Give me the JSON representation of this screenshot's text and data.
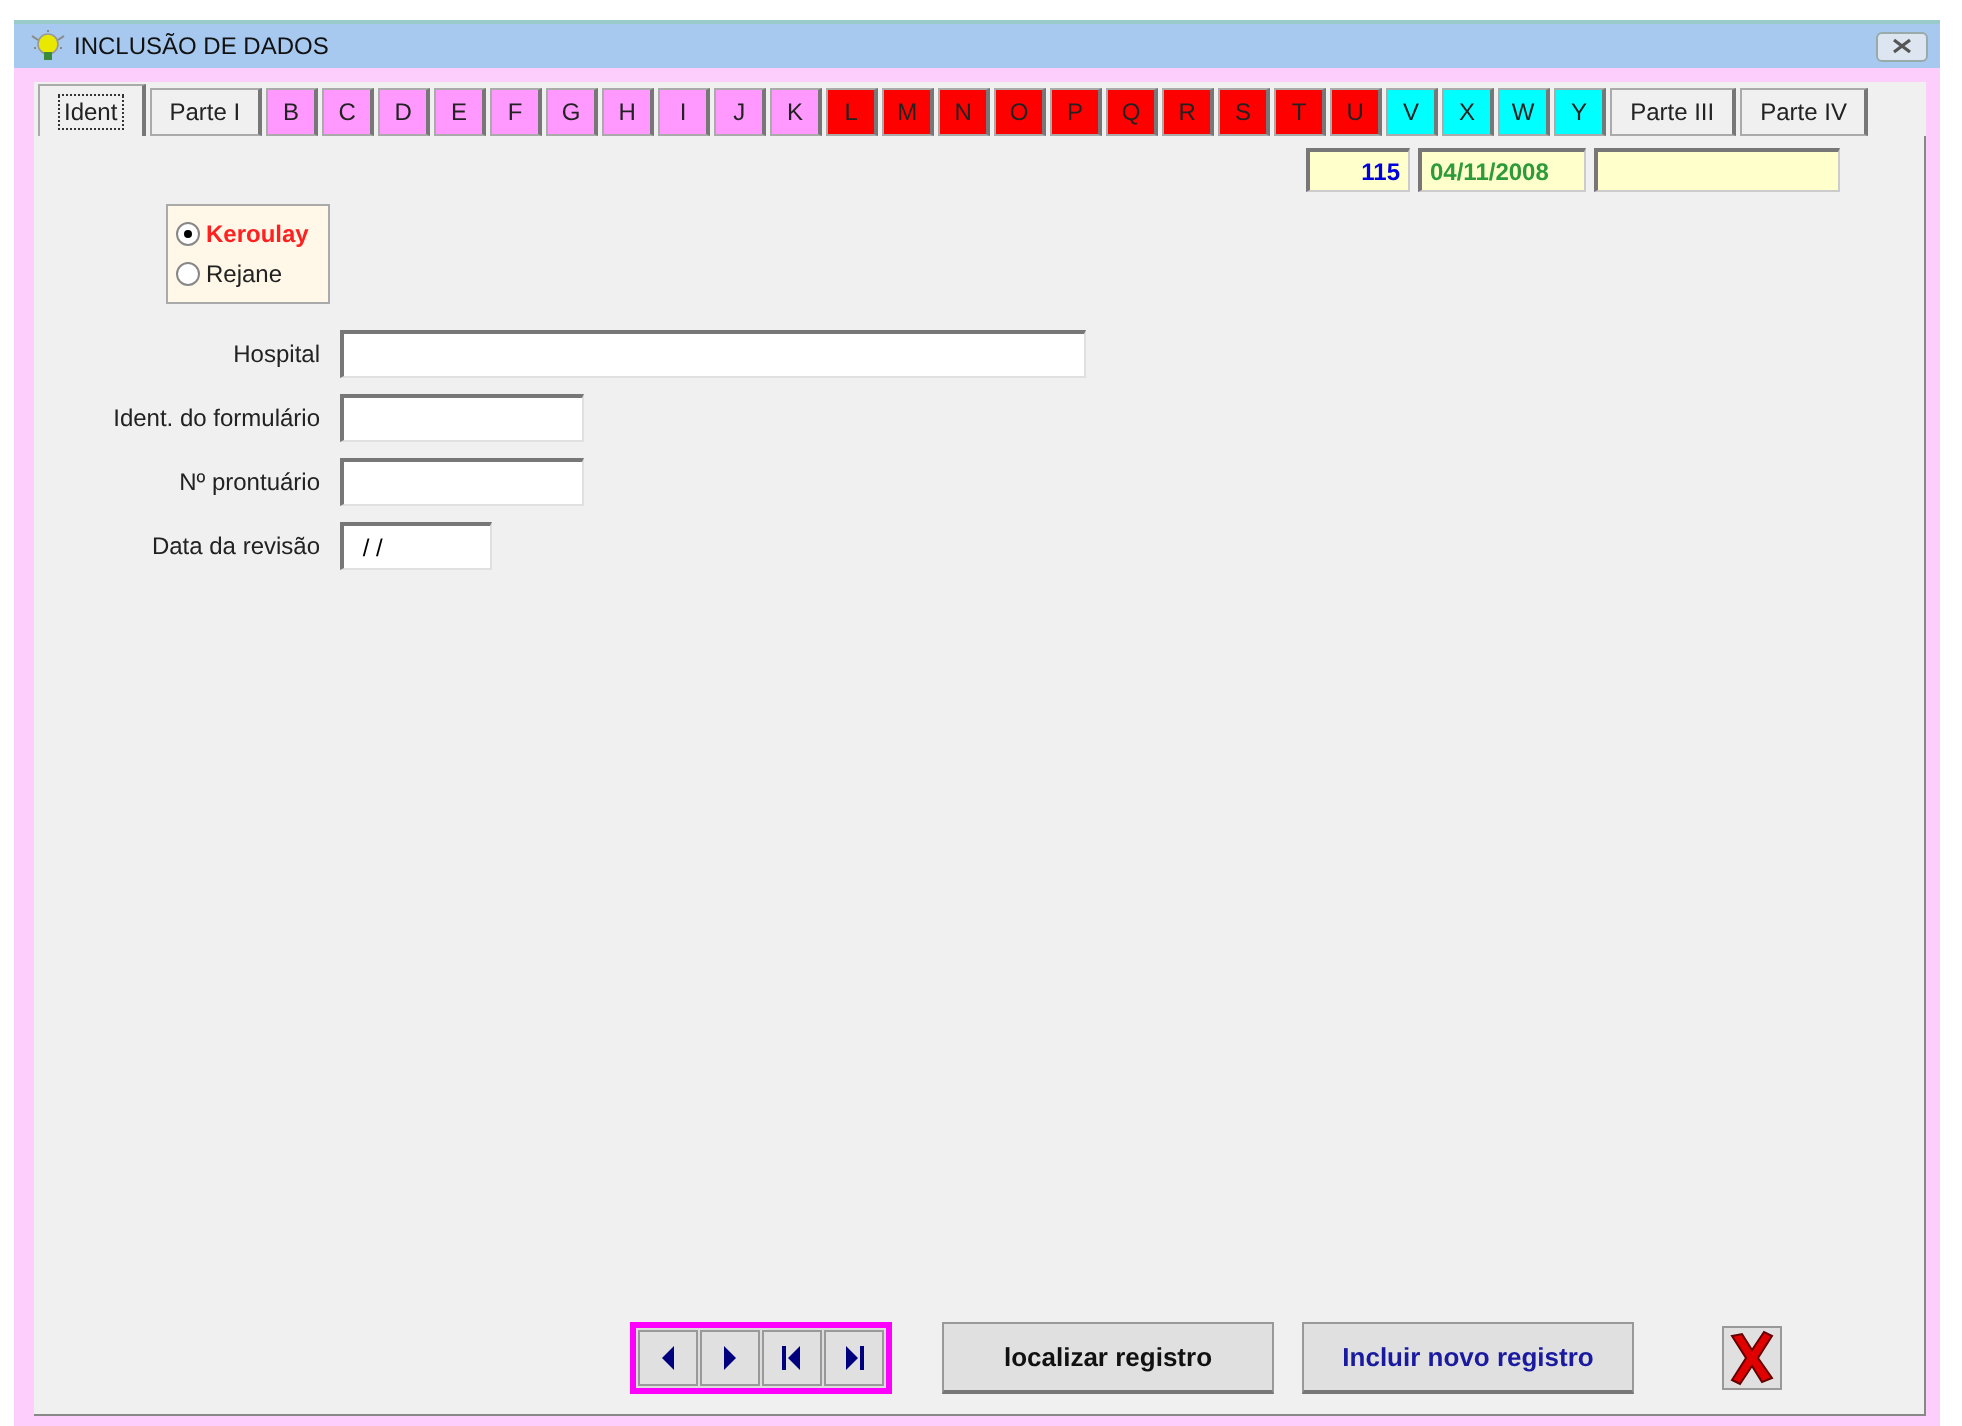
{
  "window": {
    "title": "INCLUSÃO DE DADOS"
  },
  "tabs": [
    {
      "label": "Ident",
      "selected": true,
      "color": "#f0f0f0"
    },
    {
      "label": "Parte I",
      "selected": false,
      "color": "#f0f0f0"
    },
    {
      "label": "B",
      "selected": false,
      "color": "#ff99ff"
    },
    {
      "label": "C",
      "selected": false,
      "color": "#ff99ff"
    },
    {
      "label": "D",
      "selected": false,
      "color": "#ff99ff"
    },
    {
      "label": "E",
      "selected": false,
      "color": "#ff99ff"
    },
    {
      "label": "F",
      "selected": false,
      "color": "#ff99ff"
    },
    {
      "label": "G",
      "selected": false,
      "color": "#ff99ff"
    },
    {
      "label": "H",
      "selected": false,
      "color": "#ff99ff"
    },
    {
      "label": "I",
      "selected": false,
      "color": "#ff99ff"
    },
    {
      "label": "J",
      "selected": false,
      "color": "#ff99ff"
    },
    {
      "label": "K",
      "selected": false,
      "color": "#ff99ff"
    },
    {
      "label": "L",
      "selected": false,
      "color": "#ff0000"
    },
    {
      "label": "M",
      "selected": false,
      "color": "#ff0000"
    },
    {
      "label": "N",
      "selected": false,
      "color": "#ff0000"
    },
    {
      "label": "O",
      "selected": false,
      "color": "#ff0000"
    },
    {
      "label": "P",
      "selected": false,
      "color": "#ff0000"
    },
    {
      "label": "Q",
      "selected": false,
      "color": "#ff0000"
    },
    {
      "label": "R",
      "selected": false,
      "color": "#ff0000"
    },
    {
      "label": "S",
      "selected": false,
      "color": "#ff0000"
    },
    {
      "label": "T",
      "selected": false,
      "color": "#ff0000"
    },
    {
      "label": "U",
      "selected": false,
      "color": "#ff0000"
    },
    {
      "label": "V",
      "selected": false,
      "color": "#00ffff"
    },
    {
      "label": "X",
      "selected": false,
      "color": "#00ffff"
    },
    {
      "label": "W",
      "selected": false,
      "color": "#00ffff"
    },
    {
      "label": "Y",
      "selected": false,
      "color": "#00ffff"
    },
    {
      "label": "Parte III",
      "selected": false,
      "color": "#f0f0f0"
    },
    {
      "label": "Parte IV",
      "selected": false,
      "color": "#f0f0f0"
    }
  ],
  "record": {
    "number": "115",
    "date": "04/11/2008"
  },
  "radio": [
    {
      "label": "Keroulay",
      "selected": true
    },
    {
      "label": "Rejane",
      "selected": false
    }
  ],
  "fields": [
    {
      "label": "Hospital",
      "kind": "wide"
    },
    {
      "label": "Ident. do formulário",
      "kind": "medium"
    },
    {
      "label": "Nº prontuário",
      "kind": "medium"
    },
    {
      "label": "Data da revisão",
      "kind": "short",
      "value": " / /"
    }
  ],
  "buttons": [
    {
      "label": "localizar registro",
      "kind": "plain"
    },
    {
      "label": "Incluir novo registro",
      "kind": "primary"
    }
  ]
}
